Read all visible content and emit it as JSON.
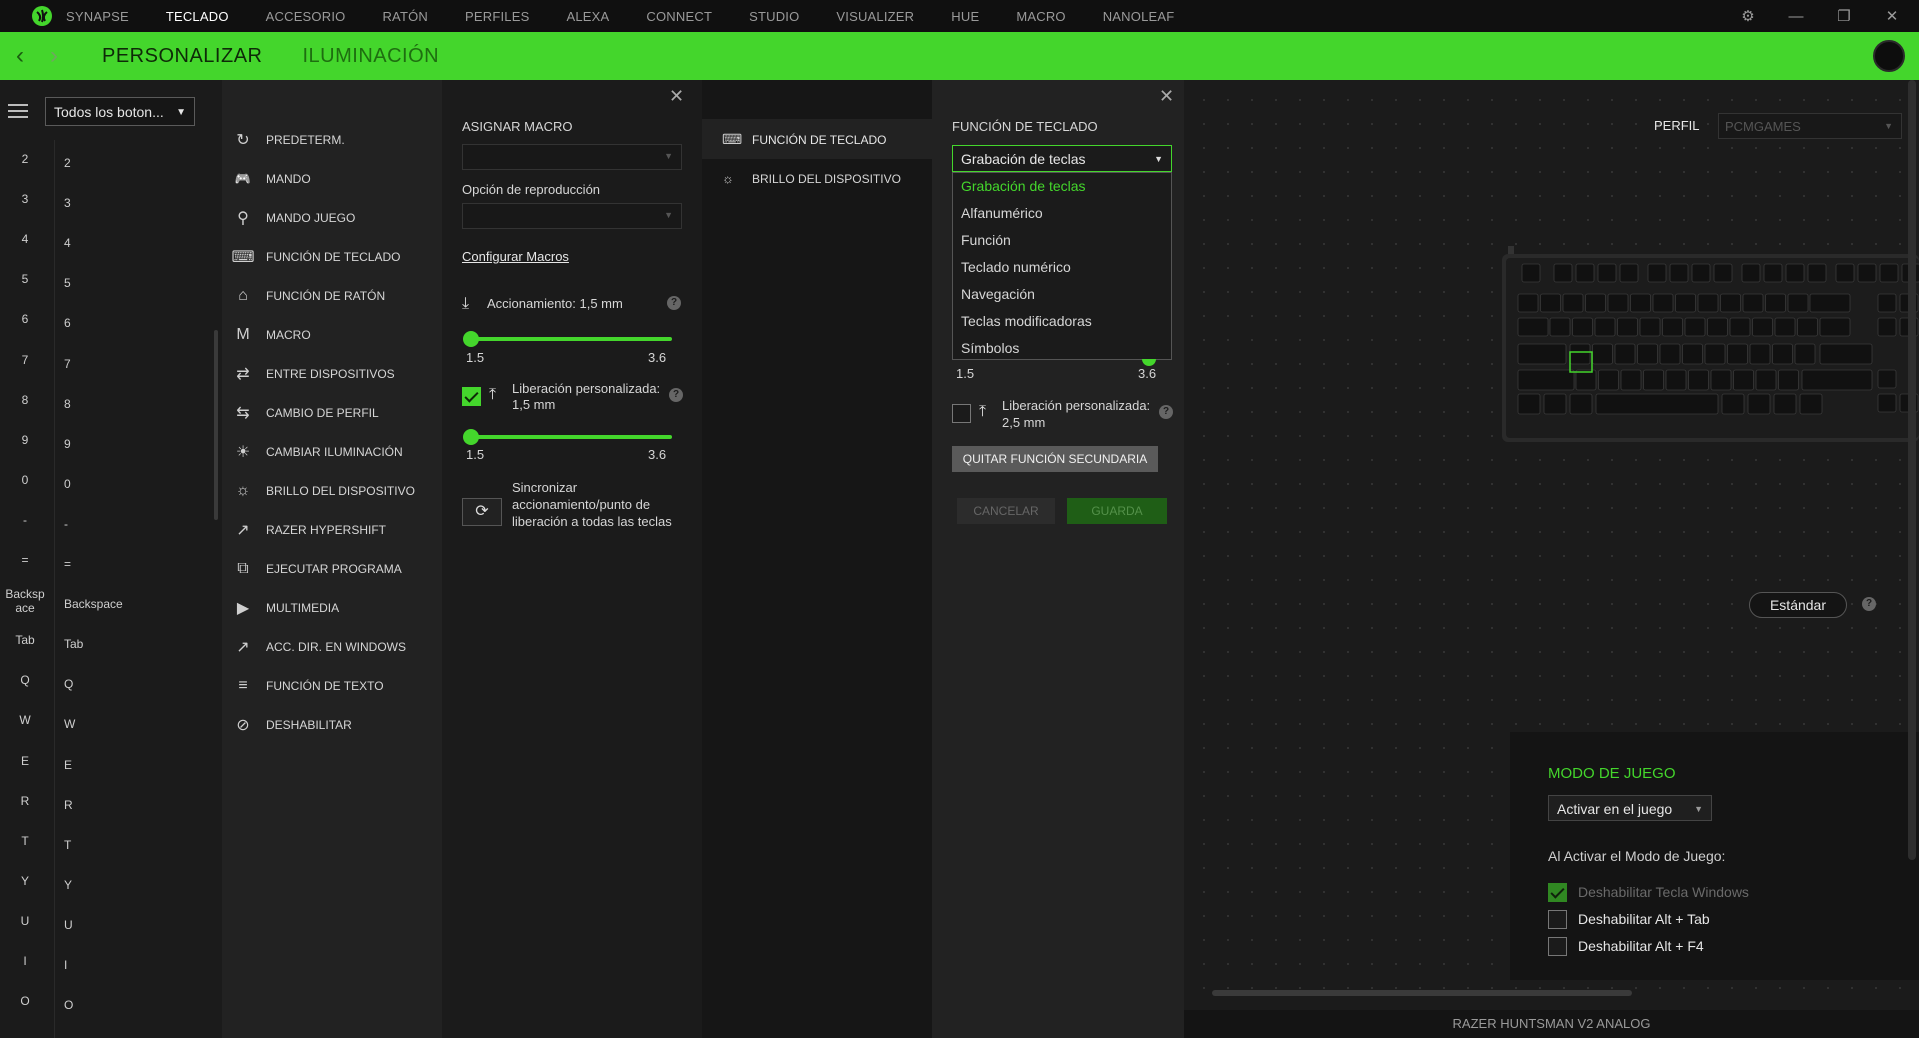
{
  "nav": {
    "tabs": [
      "SYNAPSE",
      "TECLADO",
      "ACCESORIO",
      "RATÓN",
      "PERFILES",
      "ALEXA",
      "CONNECT",
      "STUDIO",
      "VISUALIZER",
      "HUE",
      "MACRO",
      "NANOLEAF"
    ],
    "active_index": 1
  },
  "header": {
    "tab_customize": "PERSONALIZAR",
    "tab_lighting": "ILUMINACIÓN"
  },
  "left": {
    "filter": "Todos los boton...",
    "keys": [
      {
        "a": "2",
        "b": "2"
      },
      {
        "a": "3",
        "b": "3"
      },
      {
        "a": "4",
        "b": "4"
      },
      {
        "a": "5",
        "b": "5"
      },
      {
        "a": "6",
        "b": "6"
      },
      {
        "a": "7",
        "b": "7"
      },
      {
        "a": "8",
        "b": "8"
      },
      {
        "a": "9",
        "b": "9"
      },
      {
        "a": "0",
        "b": "0"
      },
      {
        "a": "-",
        "b": "-"
      },
      {
        "a": "=",
        "b": "="
      },
      {
        "a": "Backsp ace",
        "b": "Backspace"
      },
      {
        "a": "Tab",
        "b": "Tab"
      },
      {
        "a": "Q",
        "b": "Q"
      },
      {
        "a": "W",
        "b": "W"
      },
      {
        "a": "E",
        "b": "E"
      },
      {
        "a": "R",
        "b": "R"
      },
      {
        "a": "T",
        "b": "T"
      },
      {
        "a": "Y",
        "b": "Y"
      },
      {
        "a": "U",
        "b": "U"
      },
      {
        "a": "I",
        "b": "I"
      },
      {
        "a": "O",
        "b": "O"
      }
    ]
  },
  "functions": [
    {
      "label": "PREDETERM.",
      "icon": "reset-icon"
    },
    {
      "label": "MANDO",
      "icon": "gamepad-icon"
    },
    {
      "label": "MANDO JUEGO",
      "icon": "joystick-icon"
    },
    {
      "label": "FUNCIÓN DE TECLADO",
      "icon": "keyboard-icon"
    },
    {
      "label": "FUNCIÓN DE RATÓN",
      "icon": "mouse-icon"
    },
    {
      "label": "MACRO",
      "icon": "macro-icon"
    },
    {
      "label": "ENTRE DISPOSITIVOS",
      "icon": "inter-device-icon"
    },
    {
      "label": "CAMBIO DE PERFIL",
      "icon": "profile-switch-icon"
    },
    {
      "label": "CAMBIAR ILUMINACIÓN",
      "icon": "lighting-icon"
    },
    {
      "label": "BRILLO DEL DISPOSITIVO",
      "icon": "brightness-icon"
    },
    {
      "label": "RAZER HYPERSHIFT",
      "icon": "hypershift-icon"
    },
    {
      "label": "EJECUTAR PROGRAMA",
      "icon": "launch-program-icon"
    },
    {
      "label": "MULTIMEDIA",
      "icon": "multimedia-icon"
    },
    {
      "label": "ACC. DIR. EN WINDOWS",
      "icon": "shortcut-icon"
    },
    {
      "label": "FUNCIÓN DE TEXTO",
      "icon": "text-icon"
    },
    {
      "label": "DESHABILITAR",
      "icon": "disable-icon"
    }
  ],
  "macro_panel": {
    "title": "ASIGNAR MACRO",
    "playback_label": "Opción de reproducción",
    "config_link": "Configurar Macros",
    "actuation_label": "Accionamiento: 1,5 mm",
    "slider_min": "1.5",
    "slider_max": "3.6",
    "actuation_value": 1.5,
    "release_label_1": "Liberación personalizada:",
    "release_label_2": "1,5 mm",
    "release_checked": true,
    "release_value": 1.5,
    "sync_label": "Sincronizar accionamiento/punto de liberación a todas las teclas"
  },
  "mid_panel": {
    "items": [
      {
        "label": "FUNCIÓN DE TECLADO",
        "icon": "keyboard-icon"
      },
      {
        "label": "BRILLO DEL DISPOSITIVO",
        "icon": "brightness-icon"
      }
    ]
  },
  "kb_panel": {
    "title": "FUNCIÓN DE TECLADO",
    "selected": "Grabación de teclas",
    "options": [
      "Grabación de teclas",
      "Alfanumérico",
      "Función",
      "Teclado numérico",
      "Navegación",
      "Teclas modificadoras",
      "Símbolos"
    ],
    "slider_min": "1.5",
    "slider_max": "3.6",
    "release_label_1": "Liberación personalizada:",
    "release_label_2": "2,5 mm",
    "release_checked": false,
    "remove_secondary": "QUITAR FUNCIÓN SECUNDARIA",
    "cancel": "CANCELAR",
    "save": "GUARDA"
  },
  "right": {
    "profile_label": "PERFIL",
    "profile_value": "PCMGAMES",
    "standard_button": "Estándar",
    "game_mode": {
      "title": "MODO DE JUEGO",
      "mode_value": "Activar en el juego",
      "desc": "Al Activar el Modo de Juego:",
      "opt1": "Deshabilitar Tecla Windows",
      "opt1_checked": true,
      "opt2": "Deshabilitar Alt + Tab",
      "opt2_checked": false,
      "opt3": "Deshabilitar Alt + F4",
      "opt3_checked": false
    },
    "device_name": "RAZER HUNTSMAN V2 ANALOG"
  },
  "colors": {
    "accent": "#44d62c",
    "background": "#1b1b1b"
  }
}
